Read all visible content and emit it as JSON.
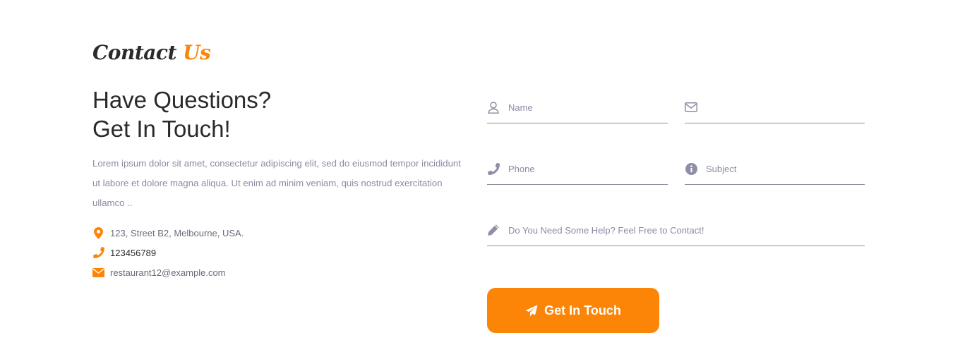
{
  "section": {
    "title_main": "Contact",
    "title_accent": "Us"
  },
  "headline": {
    "line1": "Have Questions?",
    "line2": "Get In Touch!"
  },
  "lead": "Lorem ipsum dolor sit amet, consectetur adipiscing elit, sed do eiusmod tempor incididunt ut labore et dolore magna aliqua. Ut enim ad minim veniam, quis nostrud exercitation ullamco ..",
  "contact_info": {
    "address": "123, Street B2, Melbourne, USA.",
    "phone": "123456789",
    "email": "restaurant12@example.com"
  },
  "form": {
    "name_placeholder": "Name",
    "email_placeholder": "",
    "phone_placeholder": "Phone",
    "subject_placeholder": "Subject",
    "message_placeholder": "Do You Need Some Help? Feel Free to Contact!",
    "submit_label": "Get In Touch"
  },
  "icons": {
    "address": "map-pin-icon",
    "phone": "phone-icon",
    "email": "envelope-icon",
    "name": "user-icon",
    "email_field": "envelope-outline-icon",
    "phone_field": "phone-icon",
    "subject": "info-circle-icon",
    "message": "pencil-icon",
    "submit": "paper-plane-icon"
  },
  "colors": {
    "accent": "#fc8507",
    "heading": "#2a2a2a",
    "muted": "#8b8ba3",
    "underline": "#8e8e9e"
  }
}
